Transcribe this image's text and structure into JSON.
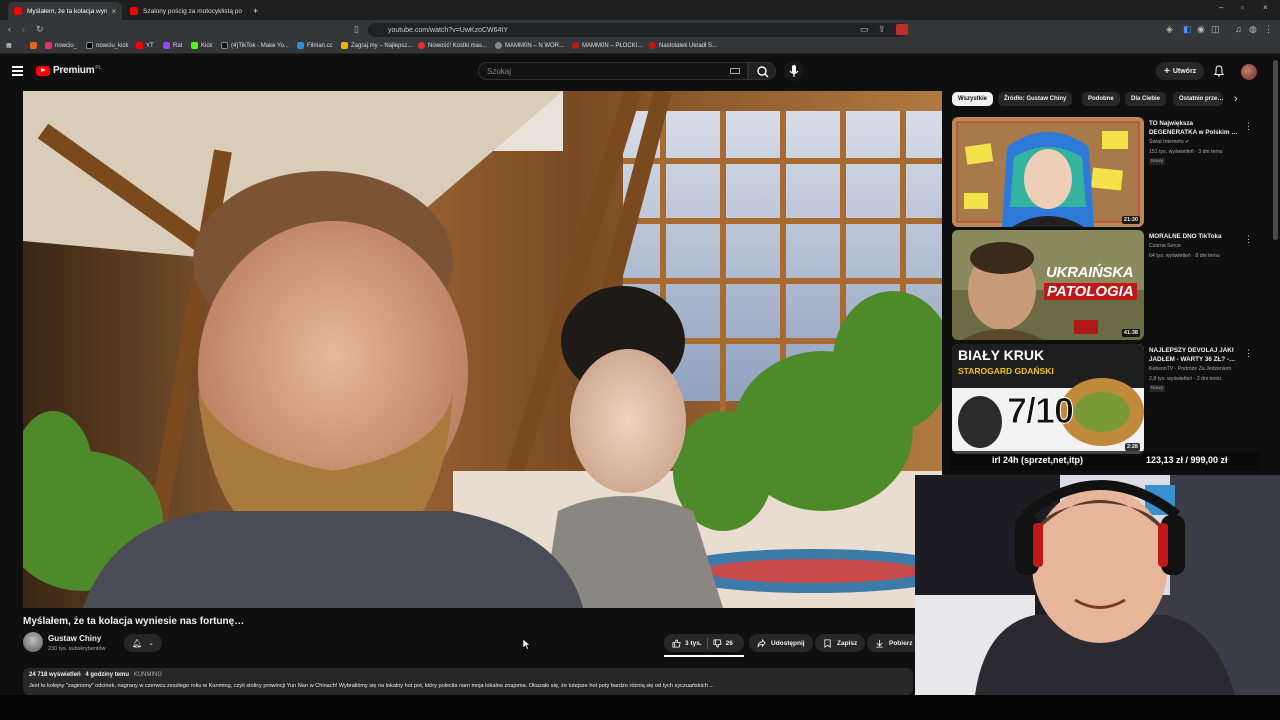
{
  "browser": {
    "tabs": [
      {
        "title": "Myślałem, że ta kolacja wynie…",
        "active": true
      },
      {
        "title": "Szalony pościg za motocyklistą po n…",
        "active": false
      }
    ],
    "new_tab": "+",
    "url": "youtube.com/watch?v=UwKzoCW64tY",
    "bookmarks": [
      {
        "label": "nowciu_",
        "color": "#e1306c"
      },
      {
        "label": "nowciu_kick",
        "color": "#000000"
      },
      {
        "label": "YT",
        "color": "#ff0000"
      },
      {
        "label": "Rat",
        "color": "#9146ff"
      },
      {
        "label": "Kick",
        "color": "#53fc18"
      },
      {
        "label": "(4)TikTok - Make Yo...",
        "color": "#111111"
      },
      {
        "label": "Filman.cc",
        "color": "#2f8fd8"
      },
      {
        "label": "Zagraj.my – Najlepsz...",
        "color": "#f2b705"
      },
      {
        "label": "Nowość! Kostki mas...",
        "color": "#e03030"
      },
      {
        "label": "MAMM0N – N WOR...",
        "color": "#888888"
      },
      {
        "label": "MAMM0N – PŁOCKI...",
        "color": "#d01010"
      },
      {
        "label": "Nastolatek Ukradł S...",
        "color": "#d01010"
      }
    ]
  },
  "youtube": {
    "logo_text": "Premium",
    "logo_region": "PL",
    "search_placeholder": "Szukaj",
    "create_label": "Utwórz"
  },
  "video": {
    "title": "Myślałem, że ta kolacja wyniesie nas fortunę…",
    "channel": "Gustaw Chiny",
    "subscribers": "230 tys. subskrybentów",
    "likes": "3 tys.",
    "dislikes": "26",
    "share_label": "Udostępnij",
    "save_label": "Zapisz",
    "download_label": "Pobierz",
    "views": "24 718 wyświetleń",
    "posted": "4 godziny temu",
    "tag": "KUNMING",
    "description": "Jest to kolejny \"zaginiony\" odcinek, nagrany w czerwcu zeszłego roku w Kunming, czyli stolicy prowincji Yun Nan w Chinach! Wybraliśmy się na lokalny hot pot, który poleciła nam moja lokalna znajoma. Okazało się, że tutejsze hot poty bardzo różnią się od tych syczuańskich ..."
  },
  "chips": [
    "Wszystkie",
    "Źródło: Gustaw Chiny",
    "Podobne",
    "Dla Ciebie",
    "Ostatnio prze…"
  ],
  "sidebar": [
    {
      "title": "TO Największa DEGENERATKA w Polskim …",
      "channel": "Świat Internetu",
      "meta": "151 tys. wyświetleń · 3 dni temu",
      "badge": "Nowy",
      "duration": "21:30"
    },
    {
      "title": "MORALNE DNO TikToka",
      "channel": "Czarne Serce",
      "meta": "64 tys. wyświetleń · 8 dni temu",
      "badge": "",
      "duration": "41:38",
      "thumb_text_1": "UKRAIŃSKA",
      "thumb_text_2": "PATOLOGIA"
    },
    {
      "title": "NAJLEPSZY DEVOLAJ JAKI JADŁEM - WARTY 36 ZŁ? -…",
      "channel": "KebsonTV - Podróże Za Jedzeniem",
      "meta": "2,8 tys. wyświetleń · 2 dni temu",
      "badge": "Nowy",
      "duration": "2:28",
      "thumb_text_1": "BIAŁY KRUK",
      "thumb_text_2": "STAROGARD GDAŃSKI",
      "thumb_text_3": "7/10"
    }
  ],
  "overlay": {
    "stream_text": "irl 24h (sprzet,net,itp)",
    "price_text": "123,13 zł / 999,00 zł"
  }
}
